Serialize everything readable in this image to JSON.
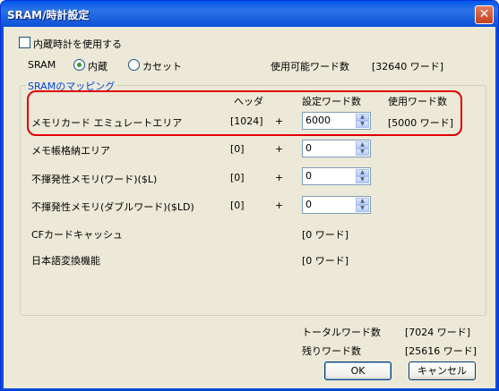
{
  "window": {
    "title": "SRAM/時計設定",
    "close_label": "✕"
  },
  "builtin_clock": {
    "label": "内蔵時計を使用する",
    "checked": false
  },
  "sram": {
    "label": "SRAM",
    "options": [
      "内蔵",
      "カセット"
    ],
    "selected": "内蔵",
    "available_label": "使用可能ワード数",
    "available_value": "[32640 ワード]"
  },
  "mapping": {
    "legend": "SRAMのマッピング",
    "headers": {
      "header": "ヘッダ",
      "setting": "設定ワード数",
      "used": "使用ワード数"
    },
    "rows": [
      {
        "label": "メモリカード エミュレートエリア",
        "header": "[1024]",
        "plus": "+",
        "value": "6000",
        "used": "[5000 ワード]"
      },
      {
        "label": "メモ帳格納エリア",
        "header": "[0]",
        "plus": "+",
        "value": "0",
        "used": ""
      },
      {
        "label": "不揮発性メモリ(ワード)($L)",
        "header": "[0]",
        "plus": "+",
        "value": "0",
        "used": ""
      },
      {
        "label": "不揮発性メモリ(ダブルワード)($LD)",
        "header": "[0]",
        "plus": "+",
        "value": "0",
        "used": ""
      },
      {
        "label": "CFカードキャッシュ",
        "setting_text": "[0 ワード]"
      },
      {
        "label": "日本語変換機能",
        "setting_text": "[0 ワード]"
      }
    ]
  },
  "totals": {
    "total_label": "トータルワード数",
    "total_value": "[7024 ワード]",
    "remaining_label": "残りワード数",
    "remaining_value": "[25616 ワード]"
  },
  "buttons": {
    "ok": "OK",
    "cancel": "キャンセル"
  }
}
